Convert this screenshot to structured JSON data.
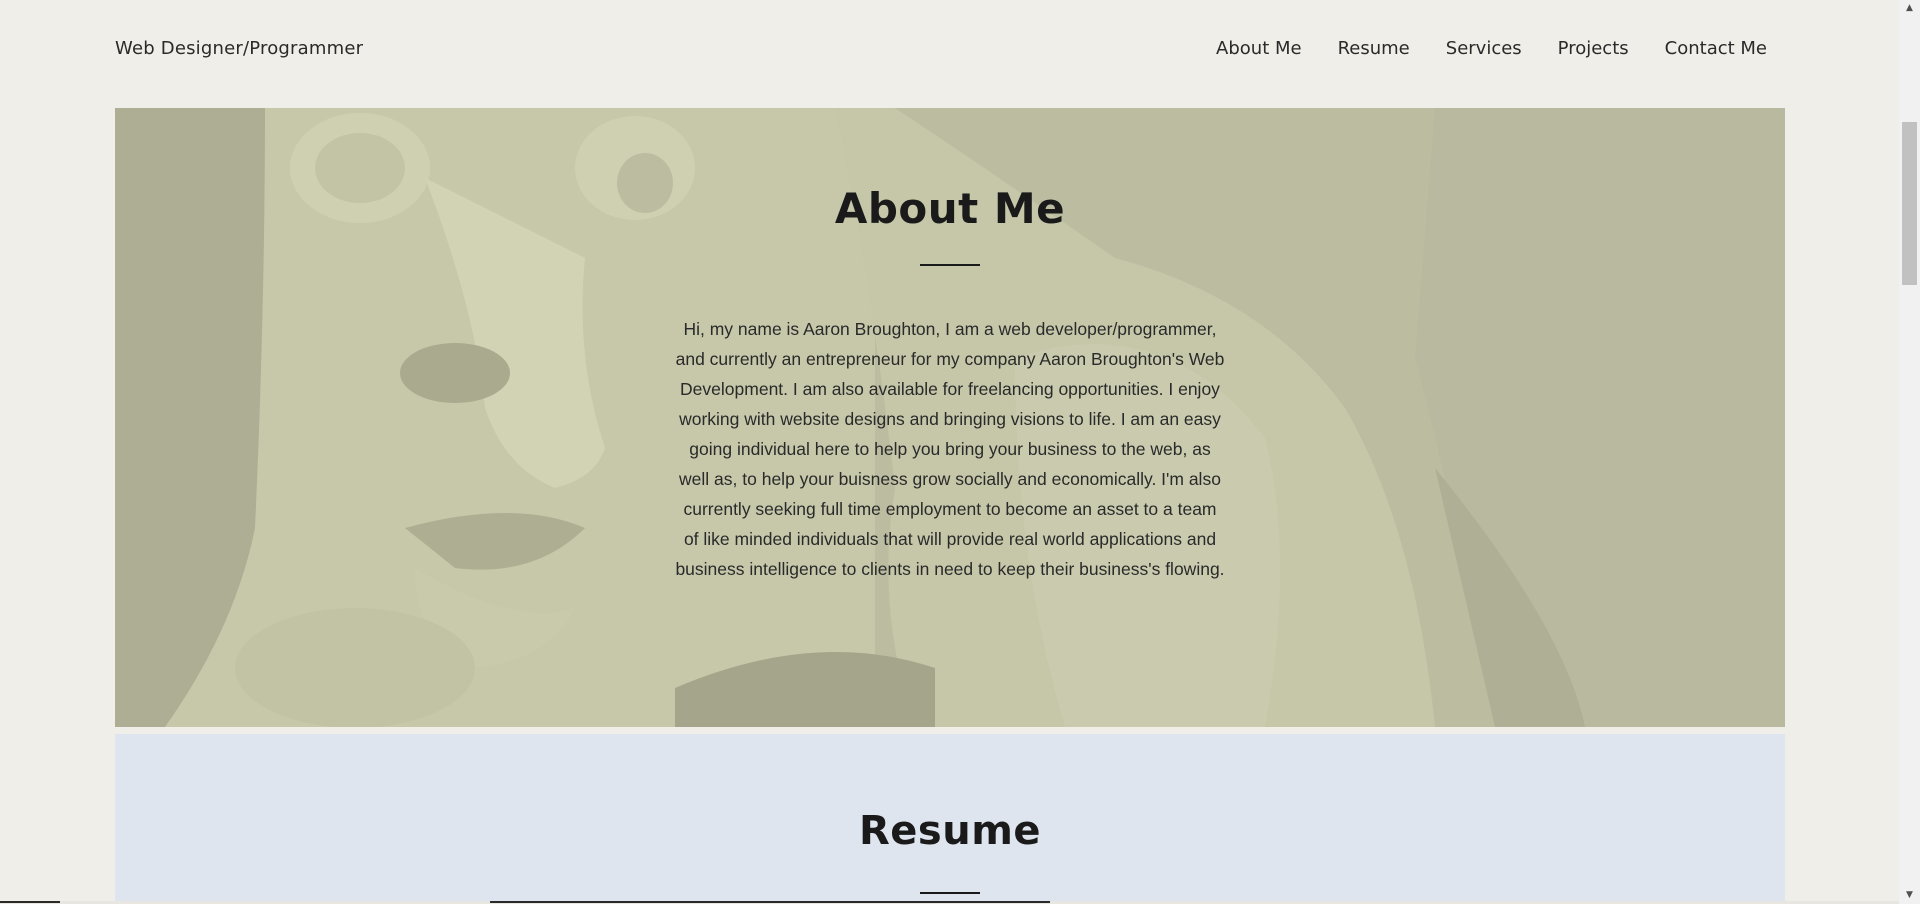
{
  "header": {
    "site_title": "Web Designer/Programmer",
    "nav": [
      {
        "label": "About Me"
      },
      {
        "label": "Resume"
      },
      {
        "label": "Services"
      },
      {
        "label": "Projects"
      },
      {
        "label": "Contact Me"
      }
    ]
  },
  "about": {
    "title": "About Me",
    "text": "Hi, my name is Aaron Broughton, I am a web developer/programmer, and currently an entrepreneur for my company Aaron Broughton's Web Development. I am also available for freelancing opportunities. I enjoy working with website designs and bringing visions to life. I am an easy going individual here to help you bring your business to the web, as well as, to help your buisness grow socially and economically. I'm also currently seeking full time employment to become an asset to a team of like minded individuals that will provide real world applications and business intelligence to clients in need to keep their business's flowing."
  },
  "resume": {
    "title": "Resume"
  },
  "colors": {
    "page_bg": "#f0eee8",
    "about_overlay": "#bdbda2",
    "resume_bg": "#dfe5ee"
  }
}
